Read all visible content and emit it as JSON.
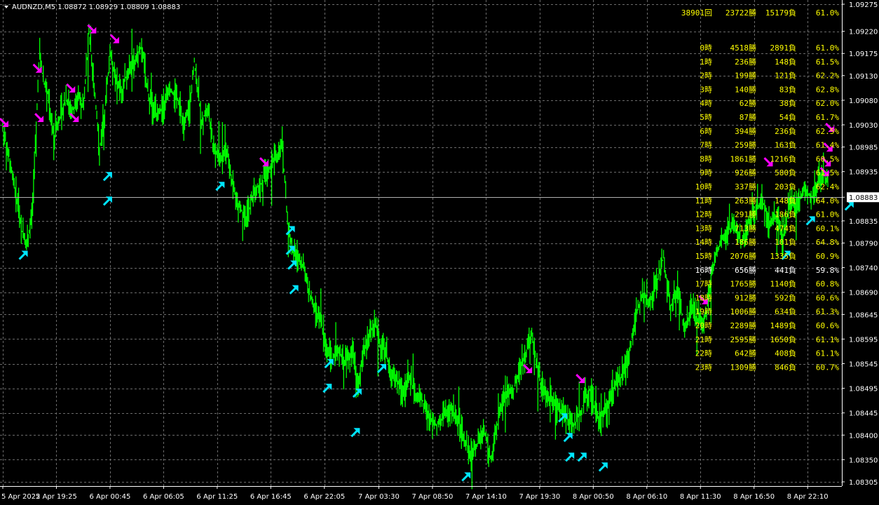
{
  "symbol_title": "AUDNZD,M5  1.08872 1.08929 1.08809 1.08883",
  "current_price": "1.08883",
  "colors": {
    "background": "#000000",
    "grid": "#6b6b6b",
    "price_line": "#00ff00",
    "buy_arrow": "#00e5ff",
    "sell_arrow": "#ff00ff",
    "stats_text": "#ffff00",
    "stats_highlight": "#ffffff",
    "axis_text": "#ffffff"
  },
  "stats": {
    "summary": [
      "38901回",
      "23722勝",
      "15179負",
      "61.0%"
    ],
    "rows": [
      [
        "0時",
        "4518勝",
        "2891負",
        "61.0%"
      ],
      [
        "1時",
        "236勝",
        "148負",
        "61.5%"
      ],
      [
        "2時",
        "199勝",
        "121負",
        "62.2%"
      ],
      [
        "3時",
        "140勝",
        "83負",
        "62.8%"
      ],
      [
        "4時",
        "62勝",
        "38負",
        "62.0%"
      ],
      [
        "5時",
        "87勝",
        "54負",
        "61.7%"
      ],
      [
        "6時",
        "394勝",
        "236負",
        "62.5%"
      ],
      [
        "7時",
        "259勝",
        "163負",
        "61.4%"
      ],
      [
        "8時",
        "1861勝",
        "1216負",
        "60.5%"
      ],
      [
        "9時",
        "926勝",
        "580負",
        "61.5%"
      ],
      [
        "10時",
        "337勝",
        "203負",
        "62.4%"
      ],
      [
        "11時",
        "263勝",
        "148負",
        "64.0%"
      ],
      [
        "12時",
        "291勝",
        "186負",
        "61.0%"
      ],
      [
        "13時",
        "713勝",
        "474負",
        "60.1%"
      ],
      [
        "14時",
        "186勝",
        "101負",
        "64.8%"
      ],
      [
        "15時",
        "2076勝",
        "1335負",
        "60.9%"
      ],
      [
        "16時",
        "656勝",
        "441負",
        "59.8%"
      ],
      [
        "17時",
        "1765勝",
        "1140負",
        "60.8%"
      ],
      [
        "18時",
        "912勝",
        "592負",
        "60.6%"
      ],
      [
        "19時",
        "1006勝",
        "634負",
        "61.3%"
      ],
      [
        "20時",
        "2289勝",
        "1489負",
        "60.6%"
      ],
      [
        "21時",
        "2595勝",
        "1650負",
        "61.1%"
      ],
      [
        "22時",
        "642勝",
        "408負",
        "61.1%"
      ],
      [
        "23時",
        "1309勝",
        "846負",
        "60.7%"
      ]
    ],
    "highlight_row": 16
  },
  "chart_data": {
    "type": "line",
    "title": "AUDNZD,M5",
    "ylim": [
      1.08305,
      1.09275
    ],
    "y_ticks": [
      "1.09275",
      "1.09220",
      "1.09175",
      "1.09130",
      "1.09080",
      "1.09030",
      "1.08985",
      "1.08935",
      "1.08883",
      "1.08835",
      "1.08790",
      "1.08740",
      "1.08690",
      "1.08645",
      "1.08595",
      "1.08545",
      "1.08495",
      "1.08445",
      "1.08400",
      "1.08350",
      "1.08305"
    ],
    "x_ticks": [
      "5 Apr 2022",
      "5 Apr 19:25",
      "6 Apr 00:45",
      "6 Apr 06:05",
      "6 Apr 11:25",
      "6 Apr 16:45",
      "6 Apr 22:05",
      "7 Apr 03:30",
      "7 Apr 08:50",
      "7 Apr 14:10",
      "7 Apr 19:30",
      "8 Apr 00:50",
      "8 Apr 06:10",
      "8 Apr 11:30",
      "8 Apr 16:50",
      "8 Apr 22:10"
    ],
    "x_tick_index": [
      0,
      61,
      122,
      183,
      244,
      305,
      366,
      428,
      489,
      550,
      611,
      672,
      733,
      794,
      855,
      916
    ],
    "n_points": 940,
    "series": [
      {
        "anchors": [
          [
            0,
            1.0902
          ],
          [
            6,
            1.0898
          ],
          [
            12,
            1.0892
          ],
          [
            20,
            1.0883
          ],
          [
            25,
            1.0879
          ],
          [
            30,
            1.0881
          ],
          [
            34,
            1.0887
          ],
          [
            38,
            1.0903
          ],
          [
            42,
            1.0918
          ],
          [
            46,
            1.0912
          ],
          [
            52,
            1.0909
          ],
          [
            58,
            1.09
          ],
          [
            64,
            1.0904
          ],
          [
            72,
            1.0908
          ],
          [
            80,
            1.0906
          ],
          [
            86,
            1.0909
          ],
          [
            92,
            1.0906
          ],
          [
            98,
            1.0922
          ],
          [
            104,
            1.0911
          ],
          [
            110,
            1.0898
          ],
          [
            116,
            1.0905
          ],
          [
            122,
            1.0918
          ],
          [
            128,
            1.0912
          ],
          [
            136,
            1.091
          ],
          [
            144,
            1.0915
          ],
          [
            150,
            1.0916
          ],
          [
            158,
            1.0919
          ],
          [
            166,
            1.0909
          ],
          [
            174,
            1.0905
          ],
          [
            182,
            1.0906
          ],
          [
            190,
            1.091
          ],
          [
            198,
            1.0909
          ],
          [
            206,
            1.0903
          ],
          [
            212,
            1.0906
          ],
          [
            218,
            1.0916
          ],
          [
            226,
            1.0904
          ],
          [
            234,
            1.0906
          ],
          [
            240,
            1.0898
          ],
          [
            248,
            1.0896
          ],
          [
            256,
            1.0898
          ],
          [
            262,
            1.089
          ],
          [
            270,
            1.0886
          ],
          [
            278,
            1.0884
          ],
          [
            286,
            1.089
          ],
          [
            294,
            1.0891
          ],
          [
            302,
            1.0894
          ],
          [
            310,
            1.0896
          ],
          [
            318,
            1.0899
          ],
          [
            324,
            1.0884
          ],
          [
            330,
            1.0877
          ],
          [
            338,
            1.0876
          ],
          [
            344,
            1.0873
          ],
          [
            350,
            1.0868
          ],
          [
            356,
            1.0865
          ],
          [
            362,
            1.0863
          ],
          [
            368,
            1.0858
          ],
          [
            374,
            1.0855
          ],
          [
            382,
            1.0857
          ],
          [
            390,
            1.0855
          ],
          [
            398,
            1.0857
          ],
          [
            404,
            1.085
          ],
          [
            410,
            1.0856
          ],
          [
            418,
            1.0861
          ],
          [
            424,
            1.0863
          ],
          [
            430,
            1.0858
          ],
          [
            436,
            1.0857
          ],
          [
            442,
            1.0852
          ],
          [
            448,
            1.0851
          ],
          [
            454,
            1.0849
          ],
          [
            462,
            1.0852
          ],
          [
            470,
            1.0848
          ],
          [
            478,
            1.0847
          ],
          [
            486,
            1.0843
          ],
          [
            494,
            1.0842
          ],
          [
            502,
            1.0844
          ],
          [
            510,
            1.0845
          ],
          [
            518,
            1.0843
          ],
          [
            526,
            1.0839
          ],
          [
            532,
            1.0836
          ],
          [
            540,
            1.0838
          ],
          [
            548,
            1.0841
          ],
          [
            556,
            1.0835
          ],
          [
            564,
            1.0843
          ],
          [
            572,
            1.0848
          ],
          [
            580,
            1.0849
          ],
          [
            588,
            1.0853
          ],
          [
            596,
            1.0857
          ],
          [
            602,
            1.0861
          ],
          [
            608,
            1.0854
          ],
          [
            614,
            1.0849
          ],
          [
            620,
            1.0848
          ],
          [
            628,
            1.0846
          ],
          [
            636,
            1.0845
          ],
          [
            644,
            1.0843
          ],
          [
            650,
            1.0842
          ],
          [
            656,
            1.0844
          ],
          [
            662,
            1.0847
          ],
          [
            668,
            1.0849
          ],
          [
            674,
            1.0845
          ],
          [
            680,
            1.0843
          ],
          [
            688,
            1.0846
          ],
          [
            696,
            1.085
          ],
          [
            704,
            1.0852
          ],
          [
            712,
            1.0856
          ],
          [
            720,
            1.0864
          ],
          [
            728,
            1.0869
          ],
          [
            736,
            1.0867
          ],
          [
            744,
            1.0871
          ],
          [
            752,
            1.0876
          ],
          [
            760,
            1.0866
          ],
          [
            768,
            1.087
          ],
          [
            776,
            1.0861
          ],
          [
            784,
            1.0866
          ],
          [
            792,
            1.0863
          ],
          [
            800,
            1.0864
          ],
          [
            808,
            1.0874
          ],
          [
            816,
            1.0879
          ],
          [
            824,
            1.0881
          ],
          [
            832,
            1.0883
          ],
          [
            840,
            1.0879
          ],
          [
            848,
            1.0883
          ],
          [
            856,
            1.0885
          ],
          [
            864,
            1.0888
          ],
          [
            872,
            1.0883
          ],
          [
            880,
            1.0884
          ],
          [
            888,
            1.088
          ],
          [
            896,
            1.0887
          ],
          [
            904,
            1.0886
          ],
          [
            912,
            1.089
          ],
          [
            920,
            1.0888
          ],
          [
            928,
            1.0892
          ],
          [
            934,
            1.0894
          ],
          [
            940,
            1.089
          ],
          [
            946,
            1.0894
          ],
          [
            952,
            1.0898
          ],
          [
            958,
            1.0892
          ],
          [
            964,
            1.0884
          ]
        ]
      }
    ],
    "sell_arrows": [
      [
        0,
        1.0902
      ],
      [
        38,
        1.0913
      ],
      [
        40,
        1.0903
      ],
      [
        76,
        1.0909
      ],
      [
        80,
        1.0903
      ],
      [
        100,
        1.0921
      ],
      [
        126,
        1.0919
      ],
      [
        296,
        1.0894
      ],
      [
        596,
        1.0852
      ],
      [
        656,
        1.085
      ],
      [
        796,
        1.0866
      ],
      [
        870,
        1.0894
      ],
      [
        940,
        1.0901
      ],
      [
        938,
        1.0897
      ],
      [
        936,
        1.0894
      ],
      [
        934,
        1.0892
      ]
    ],
    "buy_arrows": [
      [
        22,
        1.0878
      ],
      [
        118,
        1.0894
      ],
      [
        118,
        1.0889
      ],
      [
        246,
        1.0892
      ],
      [
        326,
        1.0883
      ],
      [
        326,
        1.0879
      ],
      [
        328,
        1.0876
      ],
      [
        330,
        1.0871
      ],
      [
        370,
        1.0856
      ],
      [
        368,
        1.0851
      ],
      [
        402,
        1.085
      ],
      [
        430,
        1.0855
      ],
      [
        400,
        1.0842
      ],
      [
        526,
        1.0833
      ],
      [
        636,
        1.0845
      ],
      [
        642,
        1.0841
      ],
      [
        644,
        1.0837
      ],
      [
        658,
        1.0837
      ],
      [
        682,
        1.0835
      ],
      [
        890,
        1.0878
      ],
      [
        918,
        1.0885
      ],
      [
        962,
        1.0888
      ]
    ]
  }
}
